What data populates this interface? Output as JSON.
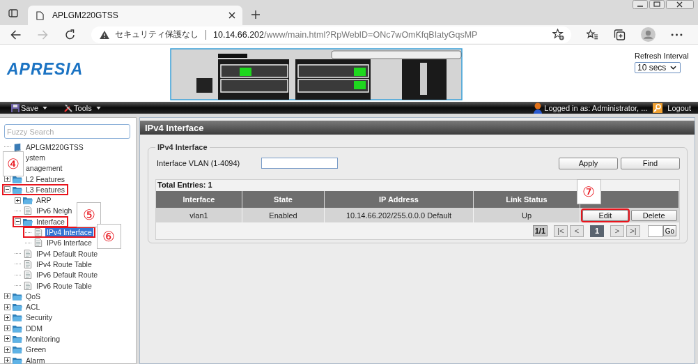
{
  "browser": {
    "tabs": [
      {
        "title": "APLGM220GTSS",
        "selected": true
      }
    ],
    "security_label": "セキュリティ保護なし",
    "url": {
      "host": "10.14.66.202",
      "path": "/www/main.html?RpWebID=ONc7wOmKfqBIatyGqsMP"
    }
  },
  "header": {
    "logo": "APRESIA",
    "refresh": {
      "label": "Refresh Interval",
      "value": "10 secs"
    }
  },
  "toolbar": {
    "menus": [
      "Save",
      "Tools"
    ],
    "user": "Logged in as: Administrator, ...",
    "logout": "Logout"
  },
  "sidebar": {
    "search_placeholder": "Fuzzy Search",
    "tree": [
      {
        "label": "APLGM220GTSS",
        "kind": "device",
        "selected": false,
        "highlighted": false
      },
      {
        "label": "ystem",
        "kind": "folder",
        "selected": false,
        "highlighted": false,
        "callout": "④"
      },
      {
        "label": "anagement",
        "kind": "folder",
        "selected": false,
        "highlighted": false
      },
      {
        "label": "L2 Features",
        "kind": "folder",
        "expanded": false,
        "selected": false,
        "highlighted": false
      },
      {
        "label": "L3 Features",
        "kind": "folder",
        "expanded": true,
        "selected": false,
        "highlighted": true,
        "children": [
          {
            "label": "ARP",
            "kind": "folder",
            "expanded": false,
            "selected": false,
            "highlighted": false
          },
          {
            "label": "IPv6 Neigh",
            "kind": "page",
            "selected": false,
            "highlighted": false,
            "callout": "⑤"
          },
          {
            "label": "Interface",
            "kind": "folder",
            "expanded": true,
            "selected": false,
            "highlighted": true,
            "children": [
              {
                "label": "IPv4 Interface",
                "kind": "page",
                "selected": true,
                "highlighted": true,
                "callout": "⑥"
              },
              {
                "label": "IPv6 Interface",
                "kind": "page",
                "selected": false,
                "highlighted": false
              }
            ]
          },
          {
            "label": "IPv4 Default Route",
            "kind": "page",
            "selected": false,
            "highlighted": false
          },
          {
            "label": "IPv4 Route Table",
            "kind": "page",
            "selected": false,
            "highlighted": false
          },
          {
            "label": "IPv6 Default Route",
            "kind": "page",
            "selected": false,
            "highlighted": false
          },
          {
            "label": "IPv6 Route Table",
            "kind": "page",
            "selected": false,
            "highlighted": false
          }
        ]
      },
      {
        "label": "QoS",
        "kind": "folder",
        "expanded": false,
        "selected": false,
        "highlighted": false
      },
      {
        "label": "ACL",
        "kind": "folder",
        "expanded": false,
        "selected": false,
        "highlighted": false
      },
      {
        "label": "Security",
        "kind": "folder",
        "expanded": false,
        "selected": false,
        "highlighted": false
      },
      {
        "label": "DDM",
        "kind": "folder",
        "expanded": false,
        "selected": false,
        "highlighted": false
      },
      {
        "label": "Monitoring",
        "kind": "folder",
        "expanded": false,
        "selected": false,
        "highlighted": false
      },
      {
        "label": "Green",
        "kind": "folder",
        "expanded": false,
        "selected": false,
        "highlighted": false
      },
      {
        "label": "Alarm",
        "kind": "folder",
        "expanded": false,
        "selected": false,
        "highlighted": false
      }
    ]
  },
  "main": {
    "title": "IPv4 Interface",
    "section": "IPv4 Interface",
    "vlan_label": "Interface VLAN (1-4094)",
    "buttons": [
      "Apply",
      "Find"
    ],
    "total": "Total Entries: 1",
    "table": {
      "columns": [
        "Interface",
        "State",
        "IP Address",
        "Link Status"
      ],
      "rows": [
        {
          "cells": [
            "vlan1",
            "Enabled",
            "10.14.66.202/255.0.0.0 Default",
            "Up"
          ],
          "actions": [
            {
              "label": "Edit",
              "highlighted": true,
              "callout": "⑦"
            },
            {
              "label": "Delete",
              "highlighted": false
            }
          ]
        }
      ]
    },
    "pager": {
      "info": "1/1",
      "buttons": [
        {
          "label": "|<",
          "disabled": true,
          "selected": false
        },
        {
          "label": "<",
          "disabled": true,
          "selected": false
        },
        {
          "label": "1",
          "disabled": false,
          "selected": true
        },
        {
          "label": ">",
          "disabled": true,
          "selected": false
        },
        {
          "label": ">|",
          "disabled": true,
          "selected": false
        }
      ],
      "go": "Go"
    }
  }
}
